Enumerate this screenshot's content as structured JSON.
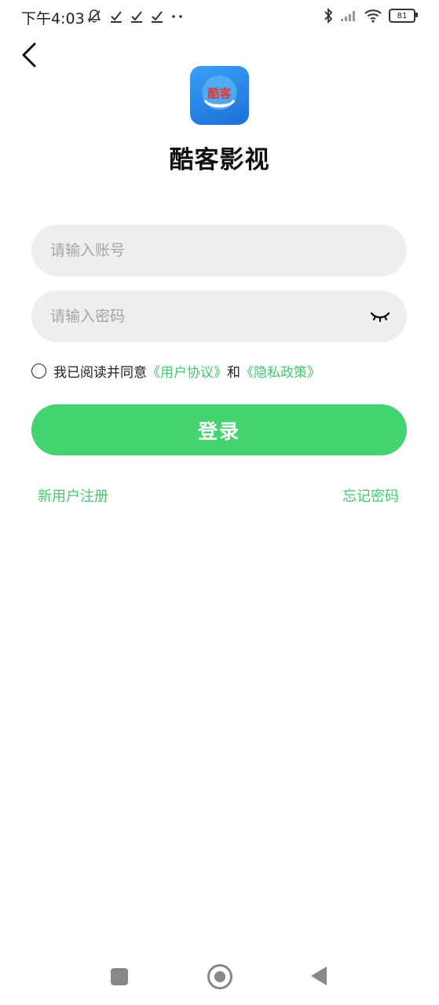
{
  "status_bar": {
    "time": "下午4:03",
    "battery": "81",
    "icons": [
      "mute-bell-icon",
      "checkmark-icon",
      "checkmark-icon",
      "checkmark-icon",
      "more-dots-icon",
      "bluetooth-icon",
      "signal-icon",
      "wifi-icon",
      "battery-icon"
    ]
  },
  "app": {
    "name": "酷客影视",
    "logo_text": "酷客",
    "logo_colors": {
      "top": "#3aa0f5",
      "bottom": "#1d6fd9",
      "text": "#e23a2f"
    }
  },
  "form": {
    "account_placeholder": "请输入账号",
    "password_placeholder": "请输入密码",
    "agreement_prefix": "我已阅读并同意",
    "user_agreement": "《用户协议》",
    "and": "和",
    "privacy_policy": "《隐私政策》",
    "login_label": "登录",
    "register_label": "新用户注册",
    "forgot_label": "忘记密码"
  },
  "colors": {
    "accent": "#45d370",
    "link": "#45c86e",
    "input_bg": "#eeeeee"
  }
}
